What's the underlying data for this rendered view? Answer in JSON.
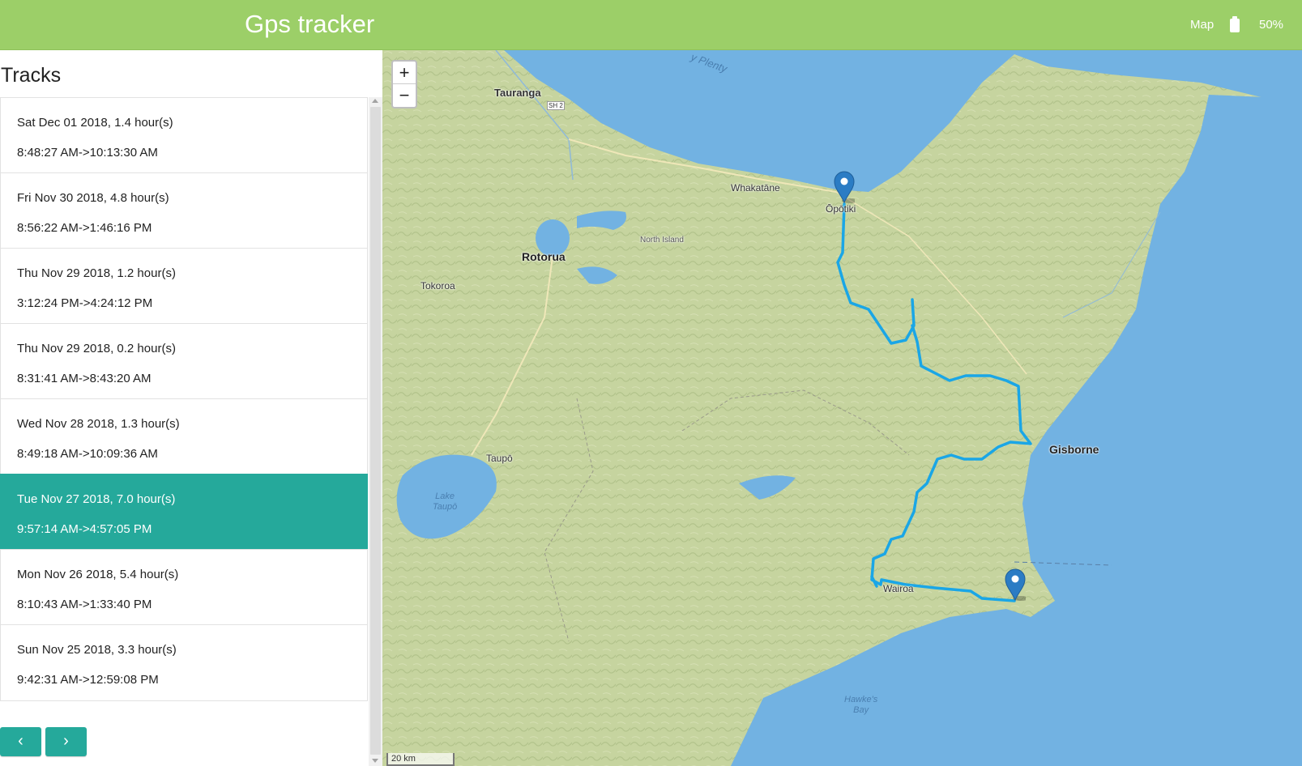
{
  "header": {
    "brand": "Gps tracker",
    "nav_map": "Map",
    "battery_icon": "battery-icon",
    "battery_level": 50,
    "battery_percent": "50%"
  },
  "sidebar": {
    "title": "Tracks",
    "tracks": [
      {
        "summary": "Sat Dec 01 2018, 1.4 hour(s)",
        "range": "8:48:27 AM->10:13:30 AM",
        "active": false
      },
      {
        "summary": "Fri Nov 30 2018, 4.8 hour(s)",
        "range": "8:56:22 AM->1:46:16 PM",
        "active": false
      },
      {
        "summary": "Thu Nov 29 2018, 1.2 hour(s)",
        "range": "3:12:24 PM->4:24:12 PM",
        "active": false
      },
      {
        "summary": "Thu Nov 29 2018, 0.2 hour(s)",
        "range": "8:31:41 AM->8:43:20 AM",
        "active": false
      },
      {
        "summary": "Wed Nov 28 2018, 1.3 hour(s)",
        "range": "8:49:18 AM->10:09:36 AM",
        "active": false
      },
      {
        "summary": "Tue Nov 27 2018, 7.0 hour(s)",
        "range": "9:57:14 AM->4:57:05 PM",
        "active": true
      },
      {
        "summary": "Mon Nov 26 2018, 5.4 hour(s)",
        "range": "8:10:43 AM->1:33:40 PM",
        "active": false
      },
      {
        "summary": "Sun Nov 25 2018, 3.3 hour(s)",
        "range": "9:42:31 AM->12:59:08 PM",
        "active": false
      }
    ],
    "pager": {
      "prev_icon": "chevron-left-icon",
      "prev_label": "‹",
      "next_icon": "chevron-right-icon",
      "next_label": "›"
    }
  },
  "map": {
    "zoom_in": "+",
    "zoom_out": "−",
    "scale": "20 km",
    "places": {
      "tauranga": "Tauranga",
      "sh2": "SH 2",
      "bay_of_plenty": "y Plenty",
      "whakatane": "Whakatāne",
      "opotiki": "Ōpōtiki",
      "rotorua": "Rotorua",
      "north_island": "North Island",
      "tokoroa": "Tokoroa",
      "taupo": "Taupō",
      "lake_taupo": "Lake\nTaupō",
      "gisborne": "Gisborne",
      "wairoa": "Wairoa",
      "hawkes_bay": "Hawke's\nBay"
    },
    "colors": {
      "track": "#1aa6e6",
      "sea": "#72b2e2",
      "land": "#c7d5a0",
      "marker": "#2b7cc4"
    }
  }
}
